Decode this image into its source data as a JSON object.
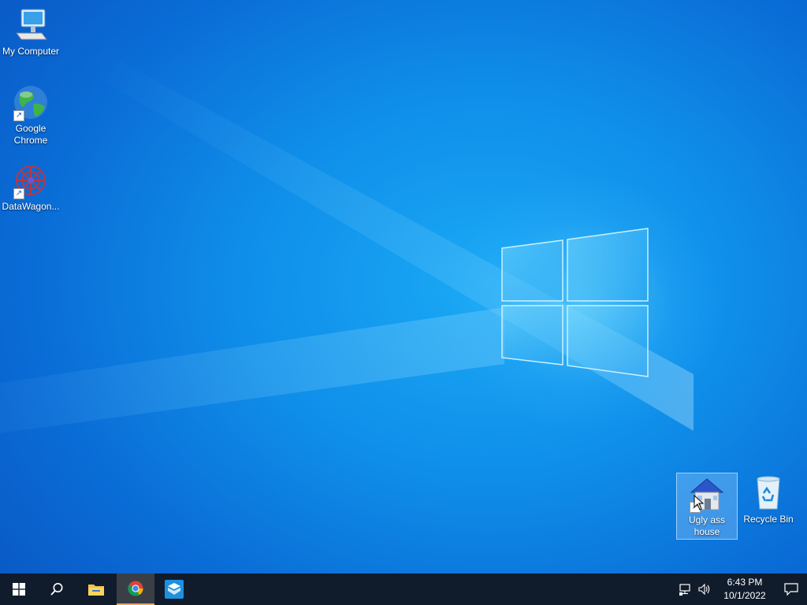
{
  "desktop": {
    "icons": [
      {
        "label": "My Computer",
        "icon": "computer-icon"
      },
      {
        "label": "Google Chrome",
        "icon": "globe-icon",
        "shortcut": true
      },
      {
        "label": "DataWagon...",
        "icon": "datawagon-icon",
        "shortcut": true
      },
      {
        "label": "Ugly ass house",
        "icon": "house-icon",
        "shortcut": true,
        "selected": true
      },
      {
        "label": "Recycle Bin",
        "icon": "recycle-bin-icon"
      }
    ],
    "wallpaper": "windows-10-logo"
  },
  "taskbar": {
    "buttons": [
      {
        "name": "start",
        "icon": "windows-start-icon"
      },
      {
        "name": "search",
        "icon": "search-icon"
      },
      {
        "name": "file-explorer",
        "icon": "folder-icon"
      },
      {
        "name": "chrome",
        "icon": "chrome-icon",
        "active": true
      },
      {
        "name": "app",
        "icon": "sandbox-app-icon"
      }
    ],
    "tray": {
      "network_icon": "network-icon",
      "volume_icon": "volume-icon"
    },
    "clock": {
      "time": "6:43 PM",
      "date": "10/1/2022"
    },
    "notification_icon": "notification-icon"
  },
  "colors": {
    "taskbar": "#101c2b",
    "active_underline": "#f0a35a",
    "wallpaper_blue": "#0f8ee9"
  }
}
